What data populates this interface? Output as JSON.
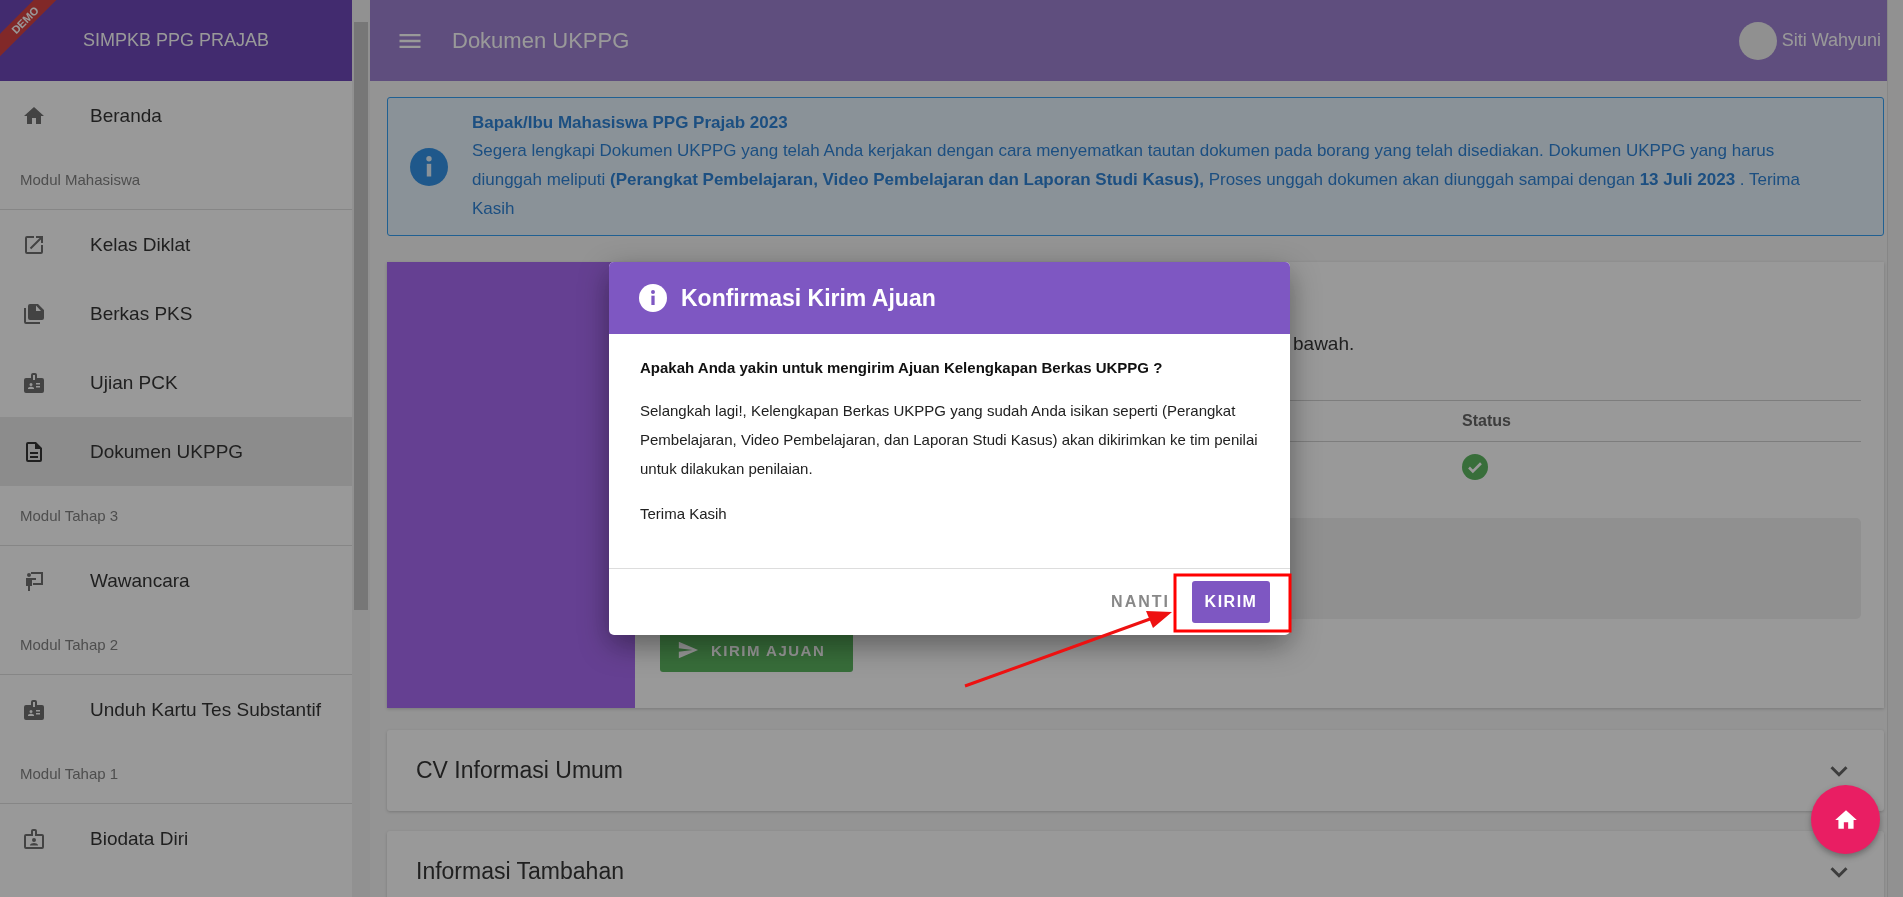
{
  "app": {
    "brand": "SIMPKB PPG PRAJAB",
    "ribbon": "DEMO"
  },
  "sidebar": {
    "items": [
      {
        "kind": "link",
        "label": "Beranda",
        "selected": false
      },
      {
        "kind": "section",
        "label": "Modul Mahasiswa"
      },
      {
        "kind": "link",
        "label": "Kelas Diklat",
        "selected": false
      },
      {
        "kind": "link",
        "label": "Berkas PKS",
        "selected": false
      },
      {
        "kind": "link",
        "label": "Ujian PCK",
        "selected": false
      },
      {
        "kind": "link",
        "label": "Dokumen UKPPG",
        "selected": true
      },
      {
        "kind": "section",
        "label": "Modul Tahap 3"
      },
      {
        "kind": "link",
        "label": "Wawancara",
        "selected": false
      },
      {
        "kind": "section",
        "label": "Modul Tahap 2"
      },
      {
        "kind": "link",
        "label": "Unduh Kartu Tes Substantif",
        "selected": false
      },
      {
        "kind": "section",
        "label": "Modul Tahap 1"
      },
      {
        "kind": "link",
        "label": "Biodata Diri",
        "selected": false
      }
    ]
  },
  "topbar": {
    "title": "Dokumen UKPPG",
    "user": "Siti Wahyuni"
  },
  "alert": {
    "title": "Bapak/Ibu Mahasiswa PPG Prajab 2023",
    "text": "Segera lengkapi Dokumen UKPPG yang telah Anda kerjakan dengan cara menyematkan tautan dokumen pada borang yang telah disediakan. Dokumen UKPPG yang harus diunggah meliputi **(Perangkat Pembelajaran, Video Pembelajaran dan Laporan Studi Kasus),** Proses unggah dokumen akan diunggah sampai dengan **13 Juli 2023** . Terima Kasih"
  },
  "card": {
    "text": "bawah.",
    "table": {
      "columns": [
        "Status"
      ],
      "rows": [
        {
          "done": true
        }
      ]
    },
    "submit_button": "KIRIM AJUAN"
  },
  "panels": [
    {
      "title": "CV Informasi Umum",
      "expanded": false
    },
    {
      "title": "Informasi Tambahan",
      "expanded": false
    }
  ],
  "dialog": {
    "title": "Konfirmasi Kirim Ajuan",
    "question": "Apakah Anda yakin untuk mengirim Ajuan Kelengkapan Berkas UKPPG ?",
    "message": "Selangkah lagi!, Kelengkapan Berkas UKPPG yang sudah Anda isikan seperti (Perangkat Pembelajaran, Video Pembelajaran, dan Laporan Studi Kasus) akan dikirimkan ke tim penilai untuk dilakukan penilaian.",
    "closing": "Terima Kasih",
    "buttons": [
      {
        "label": "NANTI",
        "kind": "text"
      },
      {
        "label": "KIRIM",
        "kind": "primary"
      }
    ]
  },
  "callout": {
    "highlight": true,
    "arrow": true
  }
}
